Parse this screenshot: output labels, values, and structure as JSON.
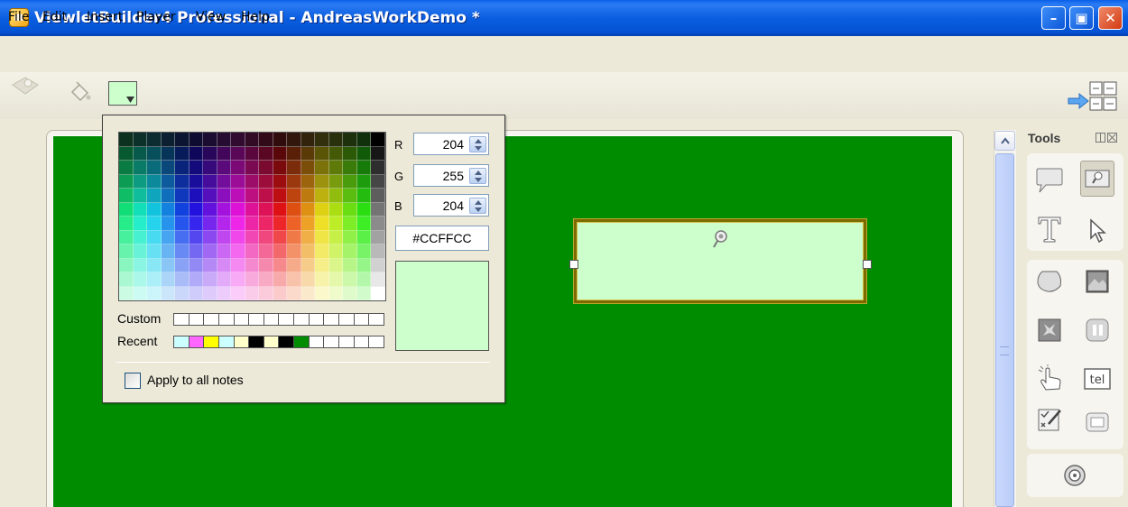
{
  "window": {
    "title": "ViewletBuilder4 Professional - AndreasWorkDemo *",
    "buttons": {
      "minimize": "–",
      "maximize": "▣",
      "close": "✕"
    }
  },
  "menu": [
    "File",
    "Edit",
    "Insert",
    "Player",
    "View",
    "Help"
  ],
  "toolbar": {
    "current_color": "#CCFFCC"
  },
  "color_picker": {
    "rgb": {
      "r_label": "R",
      "r": "204",
      "g_label": "G",
      "g": "255",
      "b_label": "B",
      "b": "204"
    },
    "hex": "#CCFFCC",
    "custom_label": "Custom",
    "recent_label": "Recent",
    "recent_colors": [
      "#CCFFFF",
      "#FF66FF",
      "#FFFF00",
      "#CCFFFF",
      "#FFFFCC",
      "#000000",
      "#FFFFCC",
      "#000000",
      "#008C00",
      "#FFFFFF",
      "#FFFFFF",
      "#FFFFFF",
      "#FFFFFF",
      "#FFFFFF"
    ],
    "apply_all_label": "Apply to all notes",
    "apply_all_checked": false
  },
  "stage": {
    "background": "#008C00",
    "note_color": "#CCFFCC"
  },
  "tools_panel": {
    "title": "Tools",
    "tools": [
      "callout-icon",
      "note-icon",
      "text-icon",
      "pointer-icon",
      "shape-icon",
      "image-icon",
      "flash-icon",
      "pause-icon",
      "click-zone-icon",
      "text-entry-icon",
      "quiz-icon",
      "button-icon",
      "audio-icon"
    ],
    "selected": "note-icon"
  }
}
